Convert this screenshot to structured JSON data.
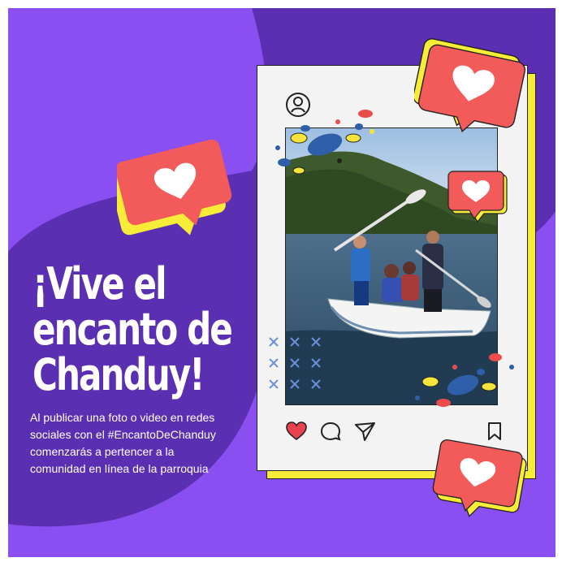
{
  "headline": {
    "line1": "¡Vive el",
    "line2": "encanto de",
    "line3": "Chanduy!"
  },
  "description": {
    "line1": "Al publicar una foto o video en redes",
    "line2": "sociales con el #EncantoDeChanduy",
    "line3": "comenzarás a pertencer a la",
    "line4": "comunidad en línea de la parroquia"
  },
  "post": {
    "icons": {
      "avatar": "user-avatar-icon",
      "like": "heart-icon",
      "comment": "comment-icon",
      "share": "send-icon",
      "save": "bookmark-icon"
    },
    "photo": "people in a small white boat with paddles on a lake surrounded by green hills"
  },
  "colors": {
    "background": "#8a4ff0",
    "background_dark": "#5b2fb2",
    "heart_bubble": "#f35a5a",
    "heart_shadow": "#f7ec38",
    "heart_fill": "#e8424f",
    "post_card": "#f3f3f3",
    "confetti_blue": "#2e5fa8",
    "confetti_yellow": "#f7e43a",
    "confetti_red": "#ec4b4b"
  }
}
